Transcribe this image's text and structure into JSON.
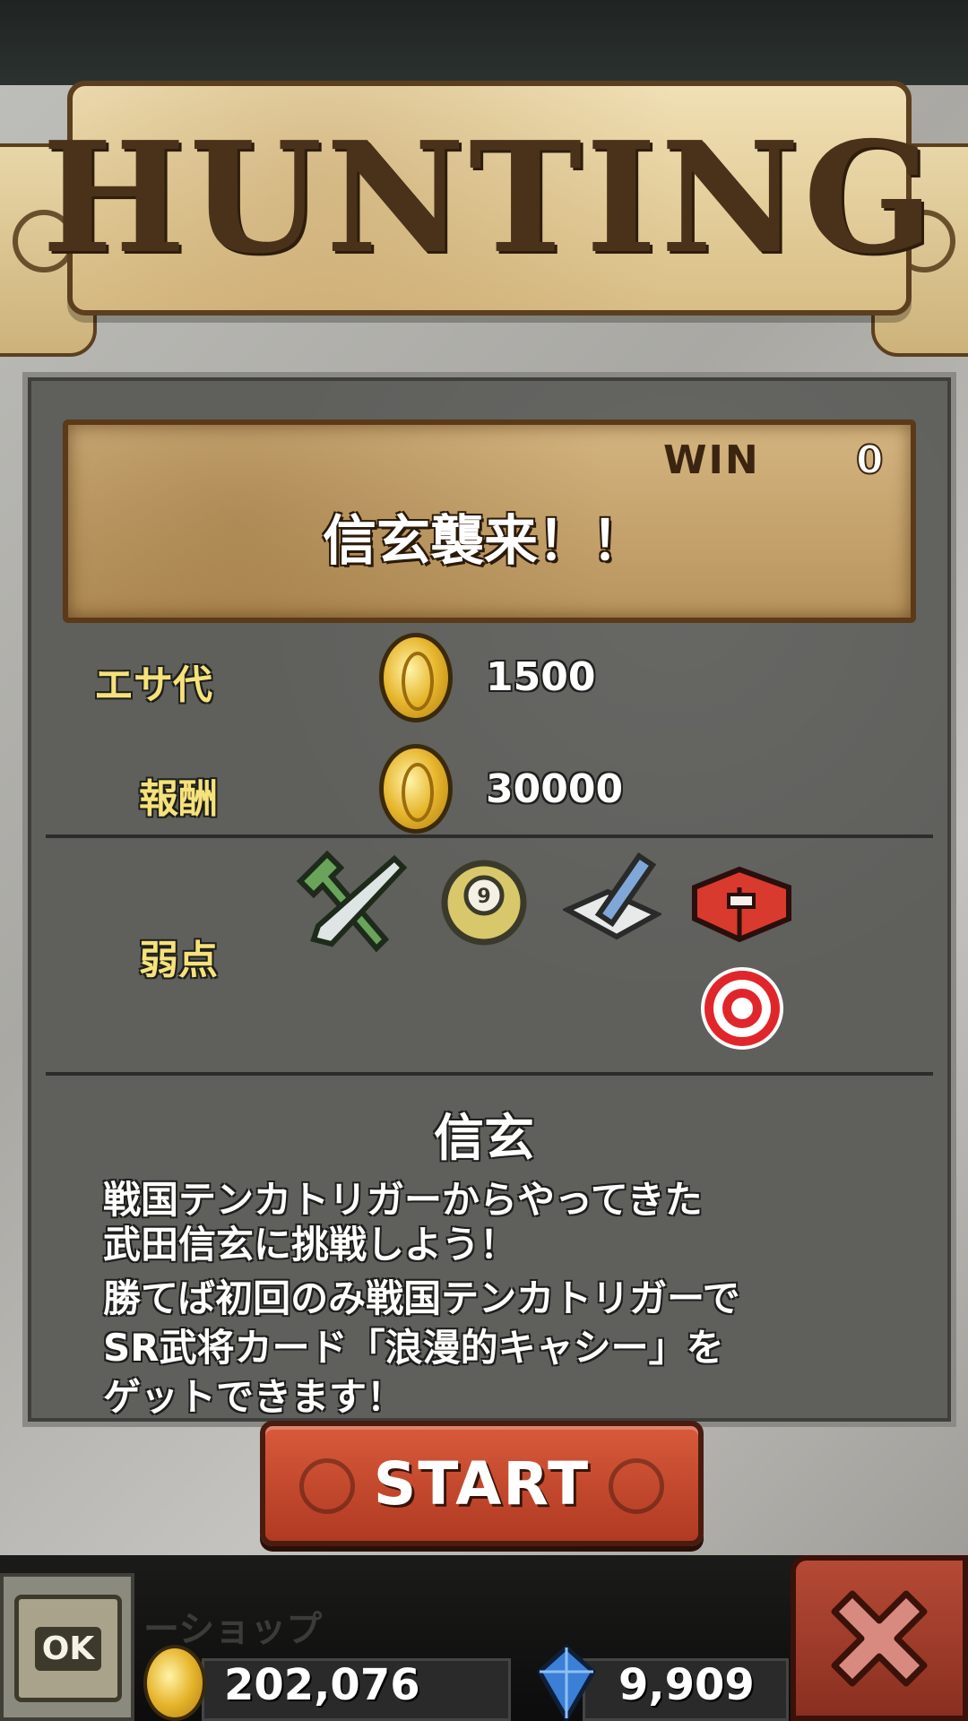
{
  "banner": {
    "title": "HUNTING"
  },
  "quest": {
    "win_label": "WIN",
    "win_count": "0",
    "title": "信玄襲来！！"
  },
  "cost": {
    "label": "エサ代",
    "value": "1500"
  },
  "reward": {
    "label": "報酬",
    "value": "30000"
  },
  "weakness": {
    "label": "弱点",
    "icons": [
      "fork-knife-icon",
      "billiard-ball-icon",
      "book-pen-icon",
      "gift-box-icon",
      "target-icon"
    ]
  },
  "detail": {
    "title": "信玄",
    "lines": [
      "戦国テンカトリガーからやってきた",
      "武田信玄に挑戦しよう！",
      "勝てば初回のみ戦国テンカトリガーで",
      "SR武将カード「浪漫的キャシー」を",
      "ゲットできます！"
    ]
  },
  "start_button": {
    "label": "START"
  },
  "footer": {
    "ok_label": "OK",
    "shop_label": "ーショップ",
    "gold": "202,076",
    "gems": "9,909"
  },
  "colors": {
    "accent_red": "#c44a2e",
    "label_yellow": "#f5e27a",
    "panel_gray": "#5f5f5c",
    "parchment": "#d4b47f"
  }
}
